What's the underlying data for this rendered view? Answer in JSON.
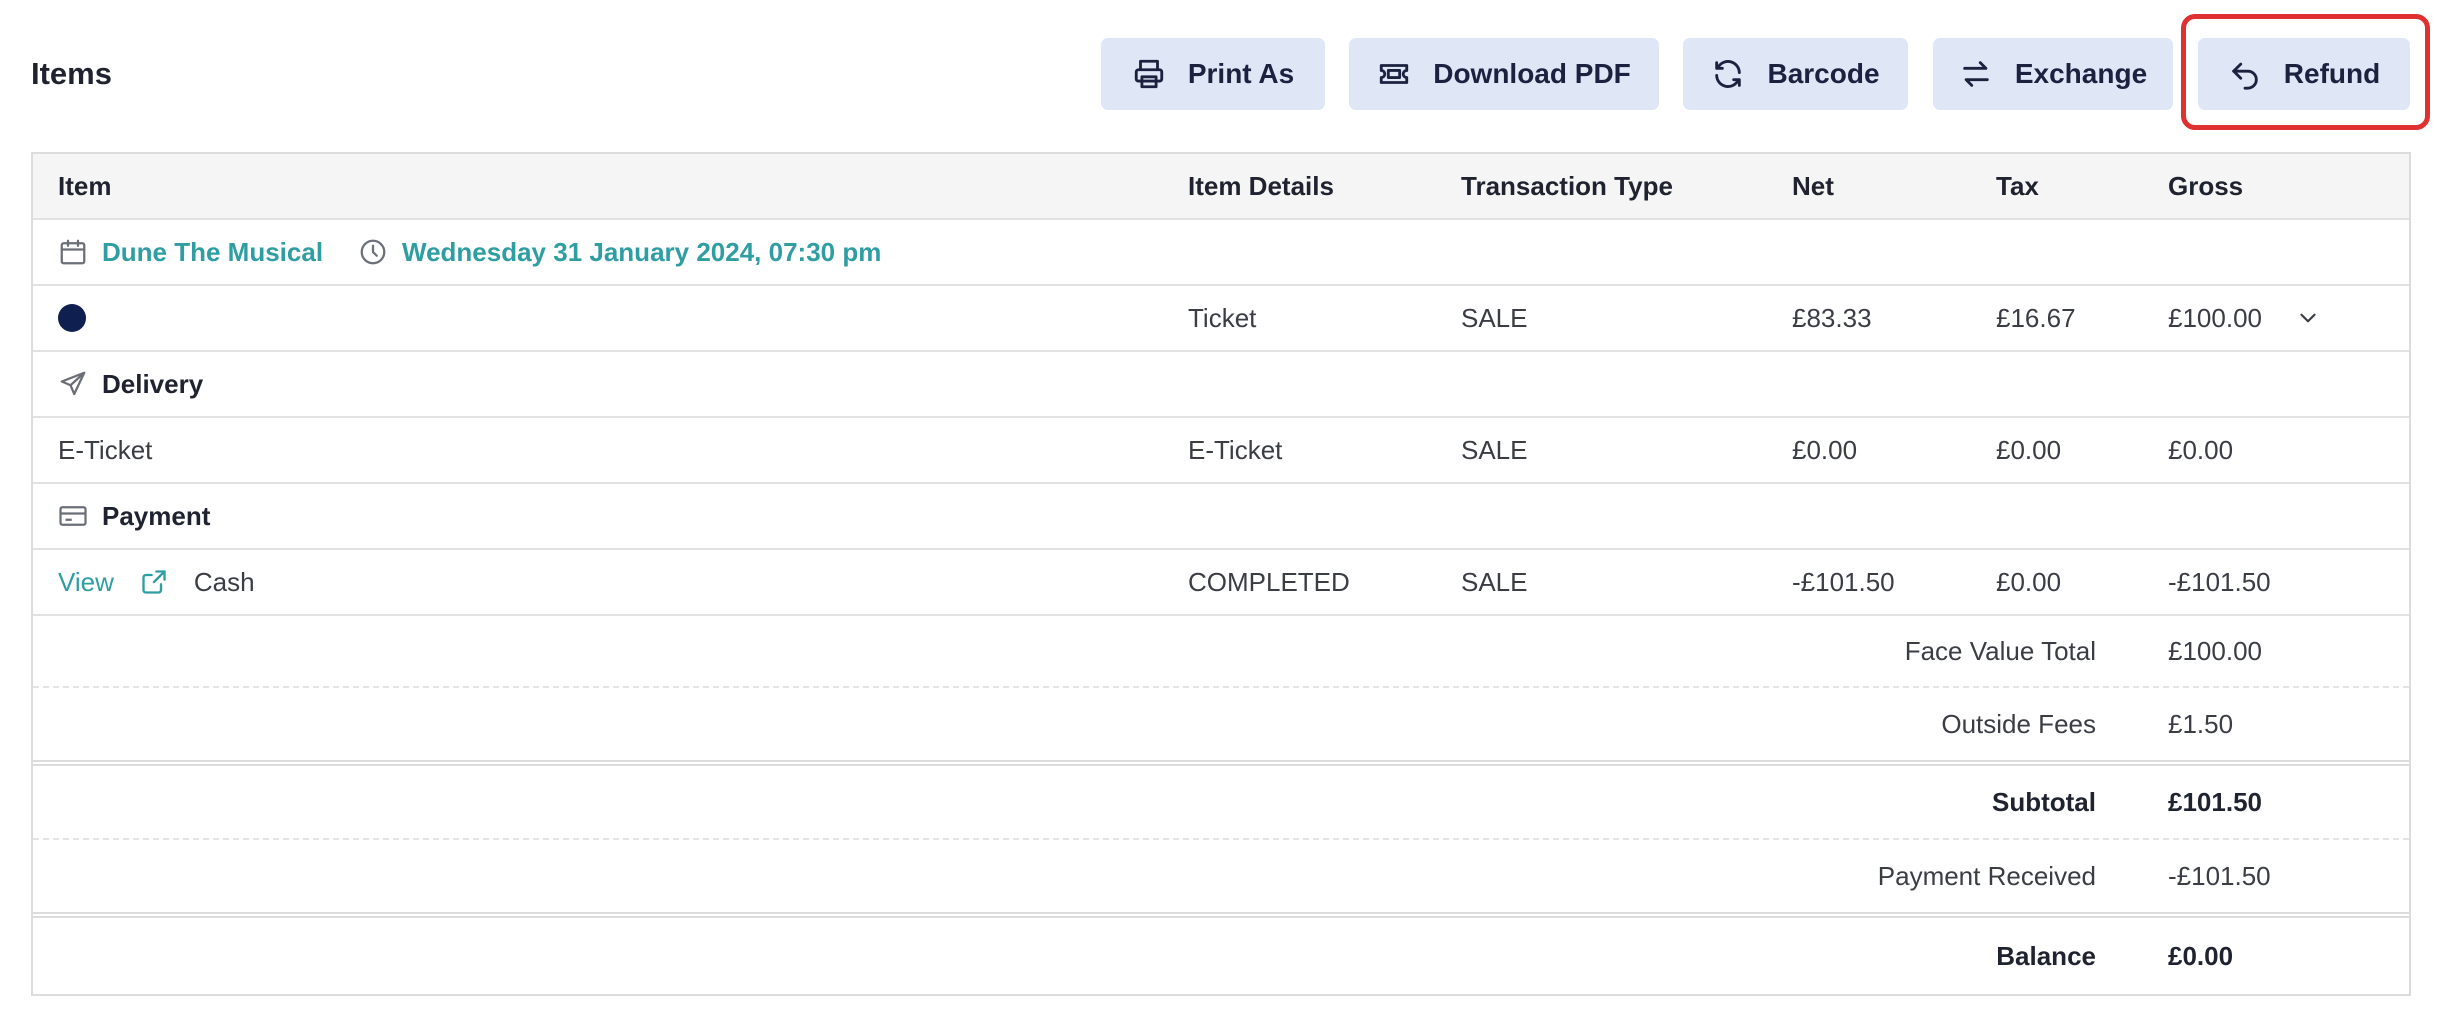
{
  "header": {
    "title": "Items",
    "buttons": {
      "print": "Print As",
      "download": "Download PDF",
      "barcode": "Barcode",
      "exchange": "Exchange",
      "refund": "Refund"
    }
  },
  "table": {
    "columns": {
      "item": "Item",
      "details": "Item Details",
      "type": "Transaction Type",
      "net": "Net",
      "tax": "Tax",
      "gross": "Gross"
    },
    "event": {
      "name": "Dune The Musical",
      "datetime": "Wednesday 31 January 2024, 07:30 pm"
    },
    "ticket_row": {
      "details": "Ticket",
      "type": "SALE",
      "net": "£83.33",
      "tax": "£16.67",
      "gross": "£100.00"
    },
    "delivery": {
      "section": "Delivery",
      "item": "E-Ticket",
      "details": "E-Ticket",
      "type": "SALE",
      "net": "£0.00",
      "tax": "£0.00",
      "gross": "£0.00"
    },
    "payment": {
      "section": "Payment",
      "view_link": "View",
      "method": "Cash",
      "details": "COMPLETED",
      "type": "SALE",
      "net": "-£101.50",
      "tax": "£0.00",
      "gross": "-£101.50"
    },
    "totals": {
      "face_value_label": "Face Value Total",
      "face_value": "£100.00",
      "outside_fees_label": "Outside Fees",
      "outside_fees": "£1.50",
      "subtotal_label": "Subtotal",
      "subtotal": "£101.50",
      "payment_received_label": "Payment Received",
      "payment_received": "-£101.50",
      "balance_label": "Balance",
      "balance": "£0.00"
    }
  },
  "colors": {
    "accent": "#2f9ea3",
    "button_bg": "#dfe6f5",
    "highlight": "#e03131",
    "ticket_dot": "#0f1f4f"
  }
}
